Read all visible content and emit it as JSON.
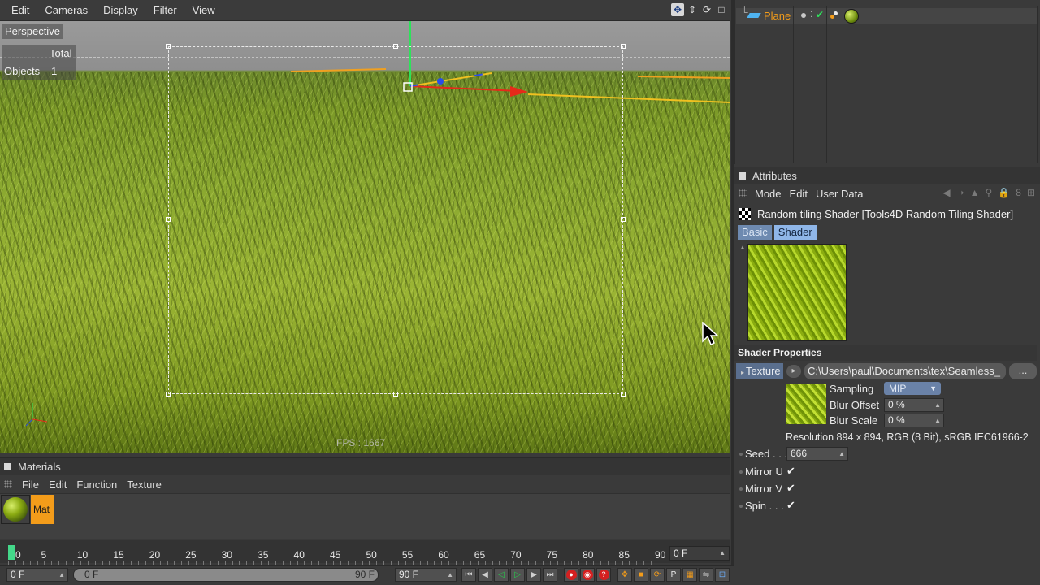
{
  "viewport": {
    "menu": [
      "Edit",
      "Cameras",
      "Display",
      "Filter",
      "View"
    ],
    "camera_label": "Perspective",
    "hud_total": "Total",
    "hud_objects_label": "Objects",
    "hud_objects_value": "1",
    "fps": "FPS : 1667"
  },
  "object_manager": {
    "object_name": "Plane"
  },
  "attributes": {
    "title": "Attributes",
    "menu": [
      "Mode",
      "Edit",
      "User Data"
    ],
    "shader_title": "Random tiling Shader [Tools4D Random Tiling Shader]",
    "tabs": [
      "Basic",
      "Shader"
    ],
    "active_tab": "Shader",
    "section_title": "Shader Properties",
    "texture_label": "Texture",
    "texture_path": "C:\\Users\\paul\\Documents\\tex\\Seamless_",
    "texture_button": "...",
    "sampling_label": "Sampling",
    "sampling_value": "MIP",
    "blur_offset_label": "Blur Offset",
    "blur_offset_value": "0 %",
    "blur_scale_label": "Blur Scale",
    "blur_scale_value": "0 %",
    "resolution": "Resolution 894 x 894, RGB (8 Bit), sRGB IEC61966-2",
    "seed_label": "Seed . . .",
    "seed_value": "666",
    "mirror_u_label": "Mirror U",
    "mirror_v_label": "Mirror V",
    "spin_label": "Spin . . .",
    "checkmark": "✔"
  },
  "materials": {
    "title": "Materials",
    "menu": [
      "File",
      "Edit",
      "Function",
      "Texture"
    ],
    "material_name": "Mat"
  },
  "timeline": {
    "ticks": [
      "0",
      "5",
      "10",
      "15",
      "20",
      "25",
      "30",
      "35",
      "40",
      "45",
      "50",
      "55",
      "60",
      "65",
      "70",
      "75",
      "80",
      "85",
      "90"
    ],
    "current_frame": "0 F",
    "start_field": "0 F",
    "range_start": "0 F",
    "range_end": "90 F",
    "end_field": "90 F"
  }
}
